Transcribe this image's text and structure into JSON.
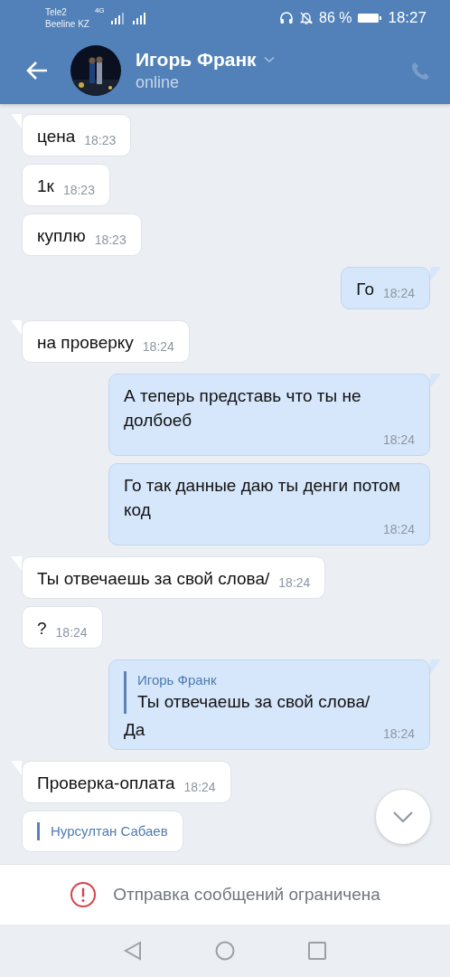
{
  "status_bar": {
    "carriers": [
      "Tele2",
      "Beeline KZ"
    ],
    "network": "4G",
    "battery": "86 %",
    "time": "18:27"
  },
  "header": {
    "name": "Игорь Франк",
    "status": "online"
  },
  "messages": [
    {
      "kind": "incoming",
      "tail": true,
      "text": "цена",
      "time": "18:23"
    },
    {
      "kind": "incoming",
      "tail": false,
      "text": "1к",
      "time": "18:23"
    },
    {
      "kind": "incoming",
      "tail": false,
      "text": "куплю",
      "time": "18:23"
    },
    {
      "kind": "outgoing",
      "tail": true,
      "text": "Го",
      "time": "18:24"
    },
    {
      "kind": "incoming",
      "tail": true,
      "text": "на проверку",
      "time": "18:24"
    },
    {
      "kind": "outgoing",
      "tail": true,
      "text": "А теперь представь что ты не долбоеб",
      "time": "18:24"
    },
    {
      "kind": "outgoing",
      "tail": false,
      "text": "Го так данные даю ты денги потом код",
      "time": "18:24"
    },
    {
      "kind": "incoming",
      "tail": true,
      "text": "Ты отвечаешь за свой слова/",
      "time": "18:24"
    },
    {
      "kind": "incoming",
      "tail": false,
      "text": "?",
      "time": "18:24"
    },
    {
      "kind": "outgoing",
      "tail": true,
      "reply": {
        "author": "Игорь Франк",
        "text": "Ты отвечаешь за свой слова/"
      },
      "text": "Да",
      "time": "18:24"
    },
    {
      "kind": "incoming",
      "tail": true,
      "text": "Проверка-оплата",
      "time": "18:24"
    },
    {
      "kind": "incoming",
      "tail": false,
      "reply": {
        "author": "Нурсултан Сабаев"
      }
    }
  ],
  "notice": "Отправка сообщений ограничена"
}
